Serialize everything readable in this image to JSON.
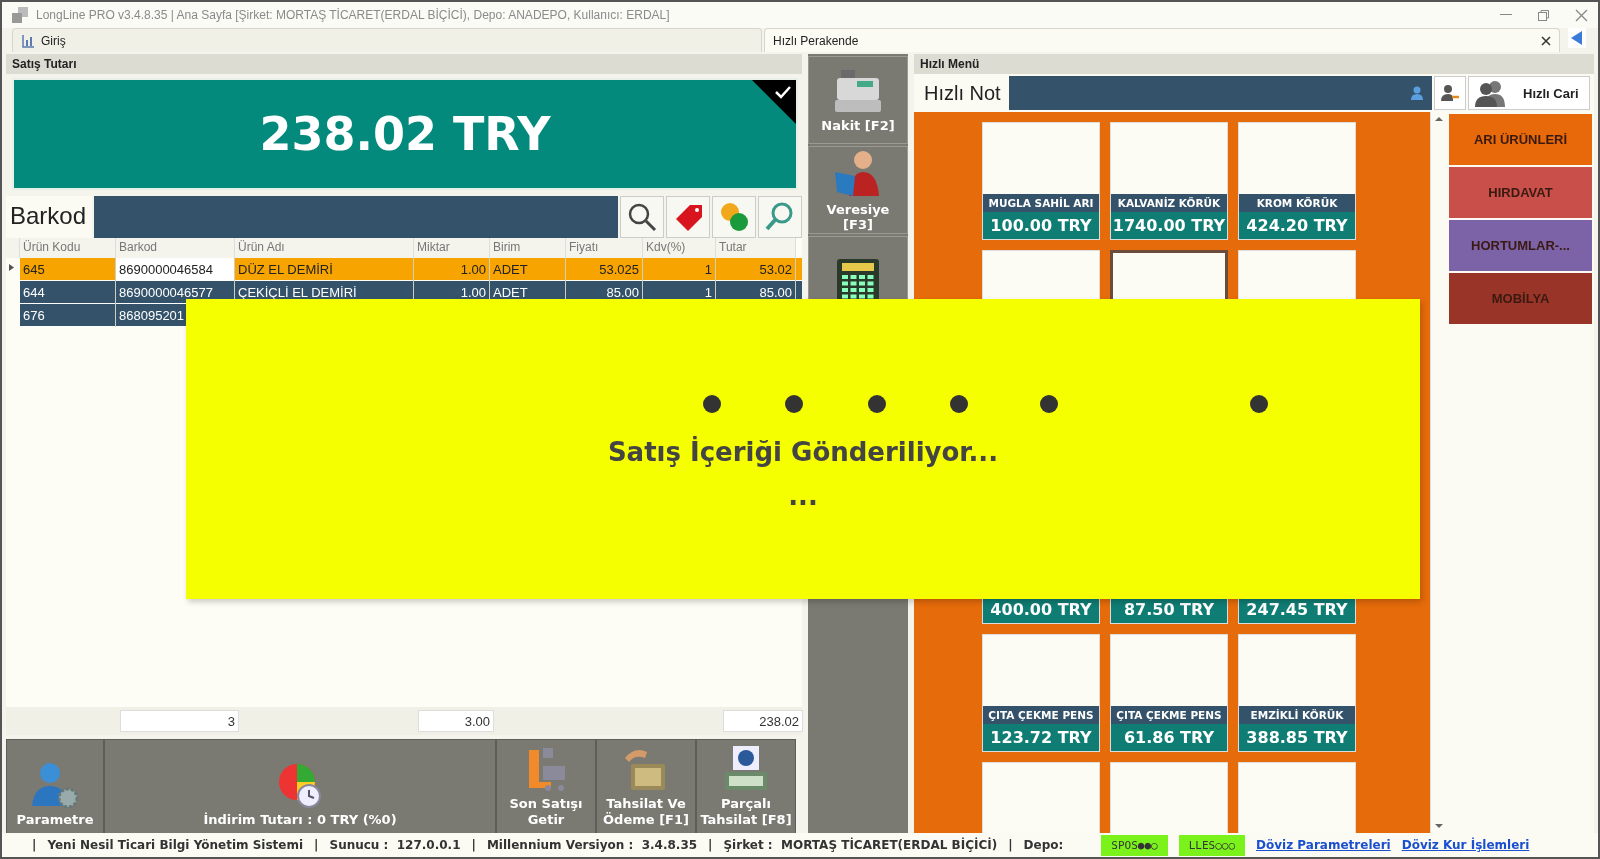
{
  "window": {
    "title": "LongLine PRO v3.4.8.35 | Ana Sayfa [Şirket: MORTAŞ TİCARET(ERDAL BİÇİCİ), Depo: ANADEPO, Kullanıcı: ERDAL]"
  },
  "tabs": [
    {
      "label": "Giriş",
      "selected": false
    },
    {
      "label": "Hızlı Perakende",
      "selected": true
    }
  ],
  "sale": {
    "title": "Satış Tutarı",
    "total": "238.02 TRY"
  },
  "barcode": {
    "label": "Barkod"
  },
  "table": {
    "columns": [
      "Ürün Kodu",
      "Barkod",
      "Ürün Adı",
      "Miktar",
      "Birim",
      "Fiyatı",
      "Kdv(%)",
      "Tutar"
    ],
    "rows": [
      {
        "selected": true,
        "cells": [
          "645",
          "8690000046584",
          "DÜZ EL DEMİRİ",
          "1.00",
          "ADET",
          "53.025",
          "1",
          "53.02"
        ]
      },
      {
        "selected": false,
        "cells": [
          "644",
          "8690000046577",
          "ÇEKİÇLİ EL DEMİRİ",
          "1.00",
          "ADET",
          "85.00",
          "1",
          "85.00"
        ]
      },
      {
        "selected": false,
        "cells": [
          "676",
          "868095201"
        ]
      }
    ],
    "totals": [
      "3",
      "3.00",
      "238.02"
    ]
  },
  "actions": [
    {
      "kind": "settings",
      "label": "Parametre"
    },
    {
      "kind": "discount",
      "label": "İndirim Tutarı : 0 TRY (%0)"
    },
    {
      "kind": "last",
      "label": "Son Satışı Getir"
    },
    {
      "kind": "payment",
      "label": "Tahsilat Ve Ödeme [F1]"
    },
    {
      "kind": "partial",
      "label": "Parçalı Tahsilat [F8]"
    }
  ],
  "payments": [
    {
      "kind": "cash",
      "label": "Nakit [F2]"
    },
    {
      "kind": "credit",
      "label": "Veresiye [F3]"
    },
    {
      "kind": "card"
    }
  ],
  "quick_menu": {
    "title": "Hızlı Menü",
    "note_label": "Hızlı Not",
    "customer_button": "Hızlı Cari",
    "tiles": [
      {
        "name": "MUGLA SAHİL ARI",
        "price": "100.00 TRY",
        "selected": false
      },
      {
        "name": "KALVANİZ KÖRÜK",
        "price": "1740.00 TRY",
        "selected": false
      },
      {
        "name": "KROM KÖRÜK",
        "price": "424.20 TRY",
        "selected": false
      },
      {
        "selected": false
      },
      {
        "selected": true
      },
      {
        "selected": false
      },
      {
        "price": "400.00 TRY",
        "selected": false
      },
      {
        "price": "87.50 TRY",
        "selected": false
      },
      {
        "price": "247.45 TRY",
        "selected": false
      },
      {
        "name": "ÇITA ÇEKME PENS",
        "price": "123.72 TRY",
        "selected": false
      },
      {
        "name": "ÇITA ÇEKME PENS",
        "price": "61.86 TRY",
        "selected": false
      },
      {
        "name": "EMZİKLİ KÖRÜK",
        "price": "388.85 TRY",
        "selected": false
      },
      {
        "selected": false
      },
      {
        "selected": false
      },
      {
        "selected": false
      }
    ],
    "categories": [
      {
        "label": "ARI ÜRÜNLERİ",
        "color": "#e8690a"
      },
      {
        "label": "HIRDAVAT",
        "color": "#c84f4a"
      },
      {
        "label": "HORTUMLAR-...",
        "color": "#7c63a8"
      },
      {
        "label": "MOBİLYA",
        "color": "#993428"
      }
    ]
  },
  "overlay": {
    "message": "Satış İçeriği Gönderiliyor...",
    "detail": "..."
  },
  "status_bar": {
    "segments": [
      "|",
      "Yeni Nesil Ticari Bilgi Yönetim Sistemi",
      "|",
      "Sunucu :  127.0.0.1",
      "|",
      "Millennium Versiyon :  3.4.8.35",
      "|",
      "Şirket :  MORTAŞ TİCARET(ERDAL BİÇİCİ)",
      "|",
      "Depo:"
    ],
    "indicators": [
      "SPOS●●○",
      "LLES○○○"
    ],
    "links": [
      "Döviz Parametreleri",
      "Döviz Kur İşlemleri"
    ]
  }
}
